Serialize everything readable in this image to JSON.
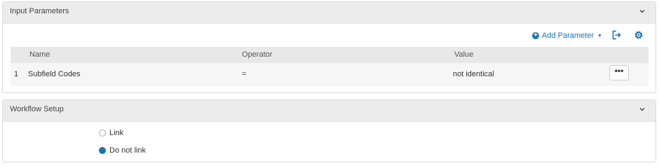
{
  "input_parameters": {
    "title": "Input Parameters",
    "add_parameter_label": "Add Parameter",
    "columns": [
      "Name",
      "Operator",
      "Value"
    ],
    "rows": [
      {
        "index": "1",
        "name": "Subfield Codes",
        "operator": "=",
        "value": "not identical",
        "action": "•••"
      }
    ]
  },
  "workflow_setup": {
    "title": "Workflow Setup",
    "options": [
      {
        "label": "Link",
        "selected": false
      },
      {
        "label": "Do not link",
        "selected": true
      }
    ]
  },
  "colors": {
    "accent": "#1a73b8",
    "header_bg": "#ececec"
  },
  "icons": {
    "collapse": "chevron-down-icon",
    "add": "plus-circle-icon",
    "export": "export-icon",
    "settings": "gear-icon"
  }
}
